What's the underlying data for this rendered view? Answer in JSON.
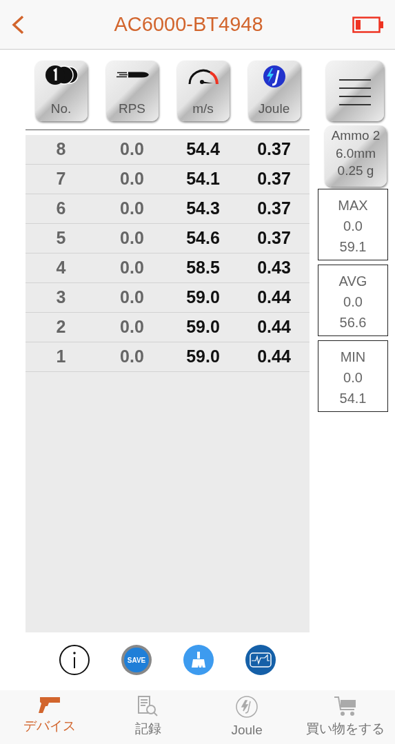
{
  "header": {
    "title": "AC6000-BT4948"
  },
  "column_buttons": [
    {
      "label": "No."
    },
    {
      "label": "RPS"
    },
    {
      "label": "m/s"
    },
    {
      "label": "Joule"
    }
  ],
  "rows": [
    {
      "no": "8",
      "rps": "0.0",
      "speed": "54.4",
      "joule": "0.37"
    },
    {
      "no": "7",
      "rps": "0.0",
      "speed": "54.1",
      "joule": "0.37"
    },
    {
      "no": "6",
      "rps": "0.0",
      "speed": "54.3",
      "joule": "0.37"
    },
    {
      "no": "5",
      "rps": "0.0",
      "speed": "54.6",
      "joule": "0.37"
    },
    {
      "no": "4",
      "rps": "0.0",
      "speed": "58.5",
      "joule": "0.43"
    },
    {
      "no": "3",
      "rps": "0.0",
      "speed": "59.0",
      "joule": "0.44"
    },
    {
      "no": "2",
      "rps": "0.0",
      "speed": "59.0",
      "joule": "0.44"
    },
    {
      "no": "1",
      "rps": "0.0",
      "speed": "59.0",
      "joule": "0.44"
    }
  ],
  "ammo": {
    "name": "Ammo 2",
    "size": "6.0mm",
    "weight": "0.25 g"
  },
  "stats": [
    {
      "label": "MAX",
      "rps": "0.0",
      "speed": "59.1"
    },
    {
      "label": "AVG",
      "rps": "0.0",
      "speed": "56.6"
    },
    {
      "label": "MIN",
      "rps": "0.0",
      "speed": "54.1"
    }
  ],
  "save_label": "SAVE",
  "tabs": [
    {
      "label": "デバイス",
      "selected": true
    },
    {
      "label": "記録",
      "selected": false
    },
    {
      "label": "Joule",
      "selected": false
    },
    {
      "label": "買い物をする",
      "selected": false
    }
  ]
}
